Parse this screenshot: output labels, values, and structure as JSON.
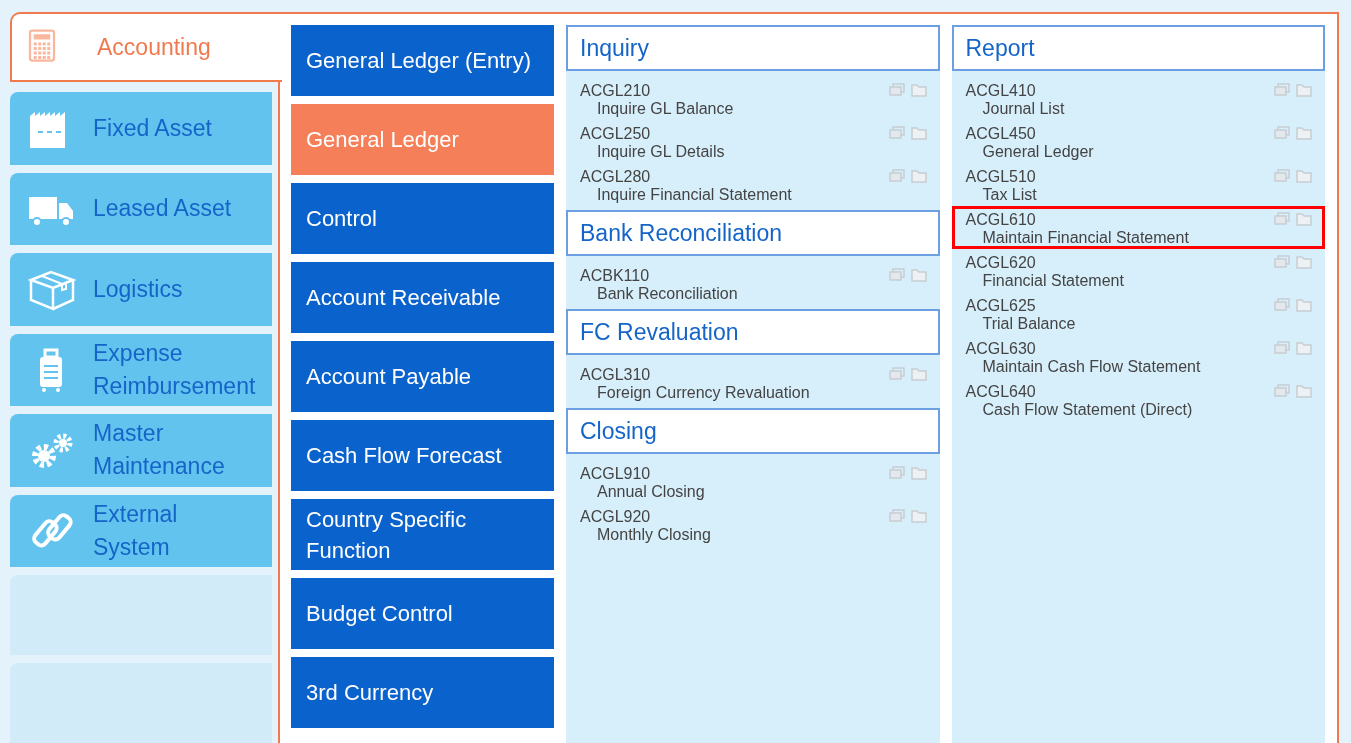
{
  "modules": [
    {
      "kind": "module",
      "label": "Accounting",
      "selected": true
    },
    {
      "kind": "module",
      "label": "Fixed Asset",
      "selected": false
    },
    {
      "kind": "module",
      "label": "Leased Asset",
      "selected": false
    },
    {
      "kind": "module",
      "label": "Logistics",
      "selected": false
    },
    {
      "kind": "module",
      "label": "Expense\nReimbursement",
      "selected": false
    },
    {
      "kind": "module",
      "label": "Master\nMaintenance",
      "selected": false
    },
    {
      "kind": "module",
      "label": "External\nSystem",
      "selected": false
    },
    {
      "kind": "blank"
    },
    {
      "kind": "blank"
    }
  ],
  "menu": [
    {
      "label": "General Ledger (Entry)",
      "selected": false
    },
    {
      "label": "General Ledger",
      "selected": true
    },
    {
      "label": "Control",
      "selected": false
    },
    {
      "label": "Account Receivable",
      "selected": false
    },
    {
      "label": "Account Payable",
      "selected": false
    },
    {
      "label": "Cash Flow Forecast",
      "selected": false
    },
    {
      "label": "Country Specific Function",
      "selected": false
    },
    {
      "label": "Budget Control",
      "selected": false
    },
    {
      "label": "3rd Currency",
      "selected": false
    }
  ],
  "columns": [
    {
      "sections": [
        {
          "title": "Inquiry",
          "items": [
            {
              "code": "ACGL210",
              "name": "Inquire GL Balance",
              "highlighted": false
            },
            {
              "code": "ACGL250",
              "name": "Inquire GL Details",
              "highlighted": false
            },
            {
              "code": "ACGL280",
              "name": "Inquire Financial Statement",
              "highlighted": false
            }
          ]
        },
        {
          "title": "Bank Reconciliation",
          "items": [
            {
              "code": "ACBK110",
              "name": "Bank Reconciliation",
              "highlighted": false
            }
          ]
        },
        {
          "title": "FC Revaluation",
          "items": [
            {
              "code": "ACGL310",
              "name": "Foreign Currency Revaluation",
              "highlighted": false
            }
          ]
        },
        {
          "title": "Closing",
          "items": [
            {
              "code": "ACGL910",
              "name": "Annual Closing",
              "highlighted": false
            },
            {
              "code": "ACGL920",
              "name": "Monthly Closing",
              "highlighted": false
            }
          ]
        }
      ]
    },
    {
      "sections": [
        {
          "title": "Report",
          "items": [
            {
              "code": "ACGL410",
              "name": "Journal List",
              "highlighted": false
            },
            {
              "code": "ACGL450",
              "name": "General Ledger",
              "highlighted": false
            },
            {
              "code": "ACGL510",
              "name": "Tax List",
              "highlighted": false
            },
            {
              "code": "ACGL610",
              "name": "Maintain Financial Statement",
              "highlighted": true
            },
            {
              "code": "ACGL620",
              "name": "Financial Statement",
              "highlighted": false
            },
            {
              "code": "ACGL625",
              "name": "Trial Balance",
              "highlighted": false
            },
            {
              "code": "ACGL630",
              "name": "Maintain Cash Flow Statement",
              "highlighted": false
            },
            {
              "code": "ACGL640",
              "name": "Cash Flow Statement (Direct)",
              "highlighted": false
            }
          ]
        }
      ]
    }
  ]
}
